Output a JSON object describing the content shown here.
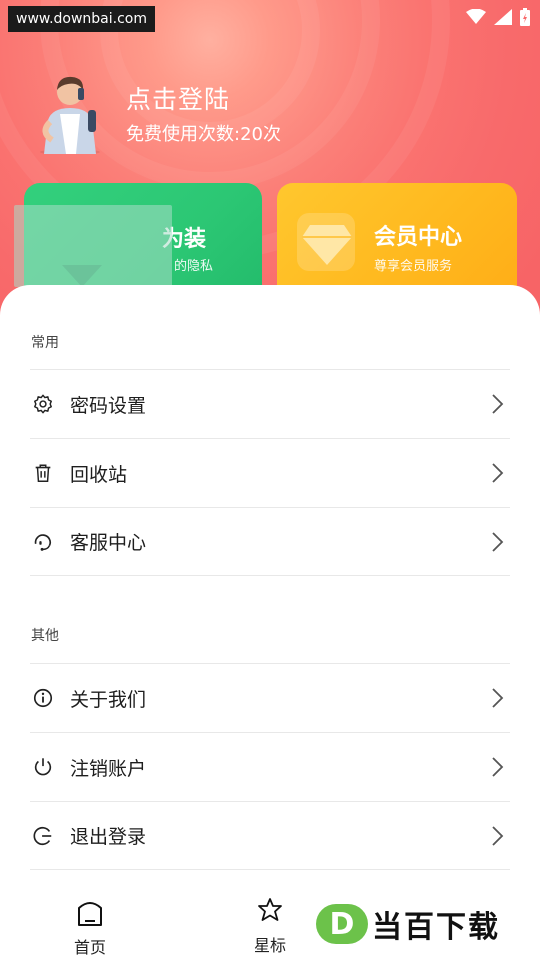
{
  "status": {
    "watermark_url": "www.downbai.com"
  },
  "user": {
    "login_text": "点击登陆",
    "free_uses": "免费使用次数:20次"
  },
  "cards": {
    "left": {
      "title": "为装",
      "subtitle": "的隐私"
    },
    "right": {
      "title": "会员中心",
      "subtitle": "尊享会员服务"
    }
  },
  "sections": {
    "common": {
      "label": "常用",
      "items": [
        {
          "label": "密码设置",
          "icon": "gear-icon"
        },
        {
          "label": "回收站",
          "icon": "trash-icon"
        },
        {
          "label": "客服中心",
          "icon": "headset-icon"
        }
      ]
    },
    "other": {
      "label": "其他",
      "items": [
        {
          "label": "关于我们",
          "icon": "info-icon"
        },
        {
          "label": "注销账户",
          "icon": "power-icon"
        },
        {
          "label": "退出登录",
          "icon": "logout-icon"
        }
      ]
    }
  },
  "nav": {
    "home": "首页",
    "star": "星标"
  },
  "logo": {
    "badge": "D",
    "text": "当百下载"
  },
  "colors": {
    "header": "#f86a6b",
    "green_card": "#2cc774",
    "yellow_card": "#ffb81e"
  }
}
